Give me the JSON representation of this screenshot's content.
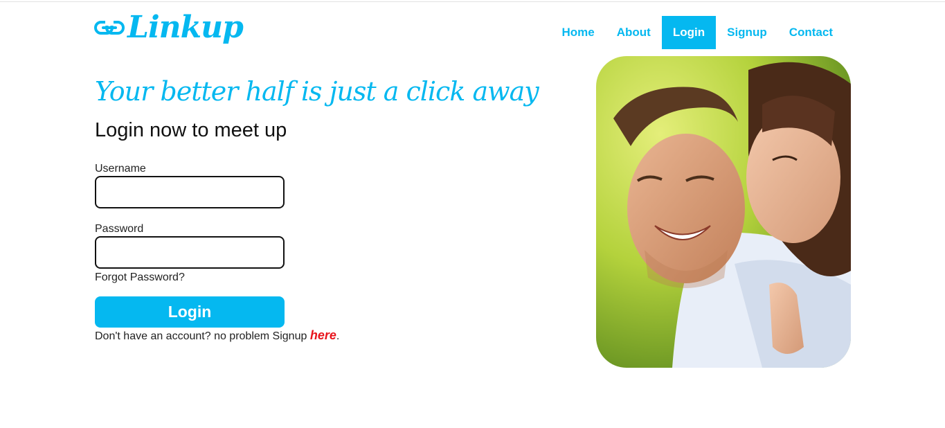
{
  "brand": {
    "name": "Linkup",
    "color": "#05b8f0"
  },
  "nav": {
    "items": [
      {
        "label": "Home",
        "active": false
      },
      {
        "label": "About",
        "active": false
      },
      {
        "label": "Login",
        "active": true
      },
      {
        "label": "Signup",
        "active": false
      },
      {
        "label": "Contact",
        "active": false
      }
    ]
  },
  "hero": {
    "tagline": "Your better half is just a click away",
    "subheading": "Login now to meet up"
  },
  "form": {
    "username_label": "Username",
    "username_value": "",
    "password_label": "Password",
    "password_value": "",
    "forgot_label": "Forgot Password?",
    "submit_label": "Login",
    "signup_prompt": "Don't have an account? no problem Signup ",
    "signup_link": "here",
    "signup_suffix": "."
  },
  "image": {
    "subject": "couple-photo"
  },
  "colors": {
    "accent": "#05b8f0",
    "link_red": "#e8141c"
  }
}
